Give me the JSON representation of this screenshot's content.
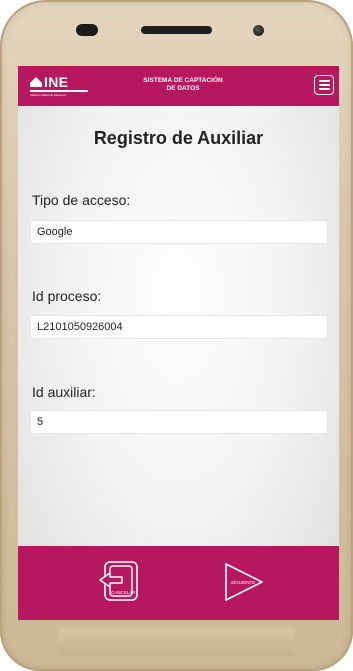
{
  "header": {
    "logo_text": "INE",
    "logo_subtext": "Instituto Nacional Electoral",
    "title_line1": "SISTEMA DE CAPTACIÓN",
    "title_line2": "DE DATOS",
    "menu_icon": "hamburger-menu-icon"
  },
  "main": {
    "page_title": "Registro de Auxiliar",
    "fields": [
      {
        "label": "Tipo de acceso:",
        "value": "Google"
      },
      {
        "label": "Id proceso:",
        "value": "L2101050926004"
      },
      {
        "label": "Id auxiliar:",
        "value": "5"
      }
    ]
  },
  "footer": {
    "cancel_label": "CANCELAR",
    "cancel_icon": "exit-door-icon",
    "next_label": "SIGUIENTE",
    "next_icon": "play-arrow-icon"
  },
  "colors": {
    "brand": "#b5185f",
    "phone_body": "#d8c6a8"
  }
}
